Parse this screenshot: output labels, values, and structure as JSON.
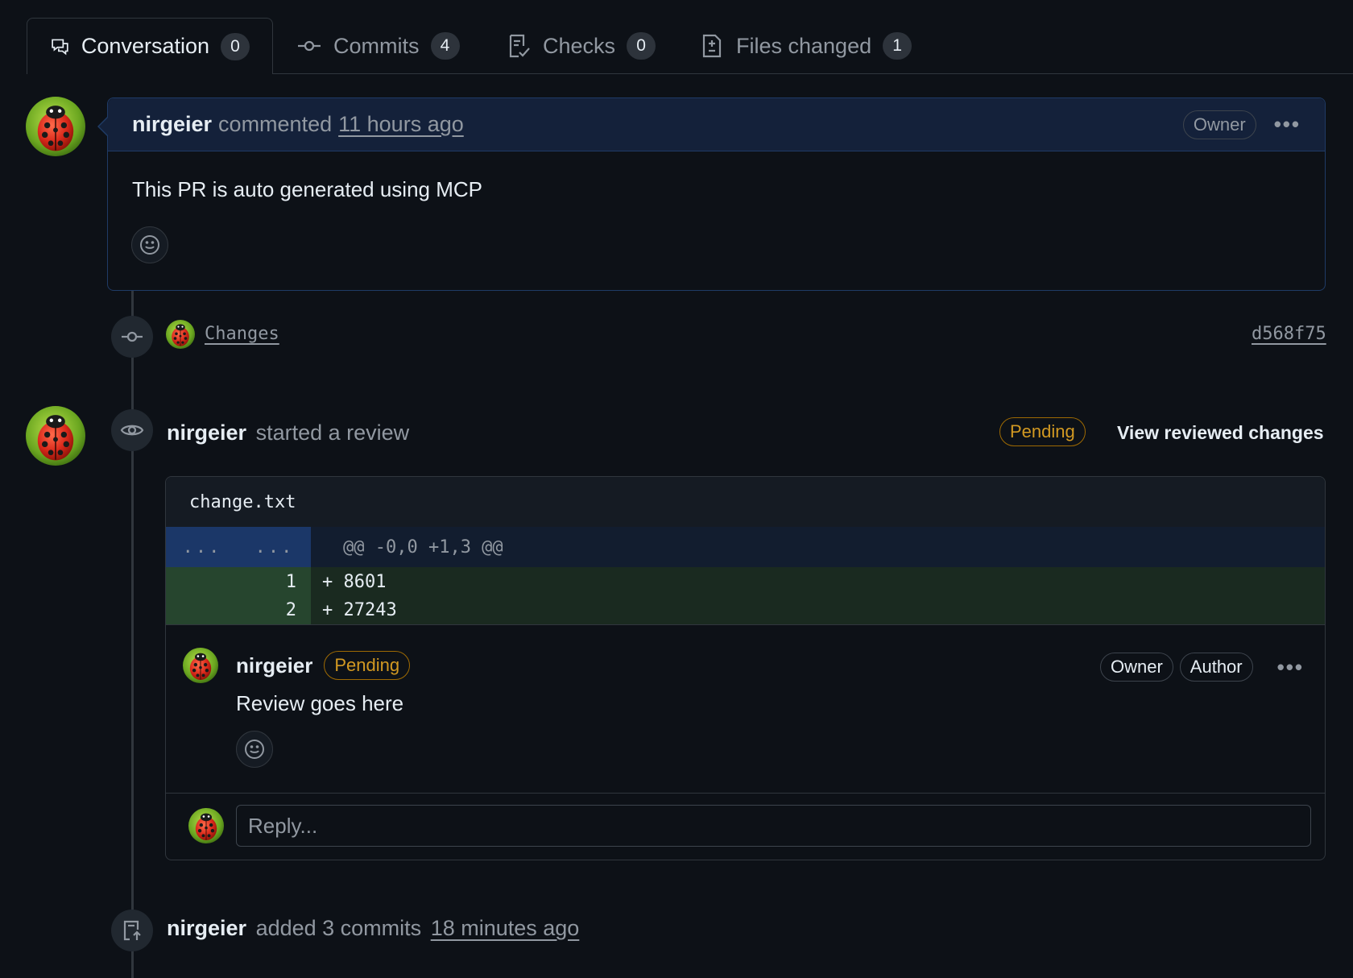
{
  "tabs": [
    {
      "label": "Conversation",
      "count": "0"
    },
    {
      "label": "Commits",
      "count": "4"
    },
    {
      "label": "Checks",
      "count": "0"
    },
    {
      "label": "Files changed",
      "count": "1"
    }
  ],
  "comment": {
    "author": "nirgeier",
    "action": "commented",
    "time": "11 hours ago",
    "badge": "Owner",
    "more": "•••",
    "body": "This PR is auto generated using MCP"
  },
  "commit": {
    "message": "Changes",
    "sha": "d568f75"
  },
  "review": {
    "author": "nirgeier",
    "action": "started a review",
    "status": "Pending",
    "view_link": "View reviewed changes",
    "file": "change.txt",
    "hunk_old": "...",
    "hunk_new": "...",
    "hunk_header": "@@ -0,0 +1,3 @@",
    "lines": [
      {
        "num": "1",
        "code": "+ 8601"
      },
      {
        "num": "2",
        "code": "+ 27243"
      }
    ],
    "inline_comment": {
      "author": "nirgeier",
      "status": "Pending",
      "badge_owner": "Owner",
      "badge_author": "Author",
      "more": "•••",
      "body": "Review goes here"
    },
    "reply_placeholder": "Reply..."
  },
  "event": {
    "author": "nirgeier",
    "action": "added 3 commits",
    "time": "18 minutes ago"
  },
  "colors": {
    "background": "#0d1117",
    "accent_blue": "#1f3b66",
    "pending": "#d29922",
    "diff_add": "#1a2a20"
  }
}
